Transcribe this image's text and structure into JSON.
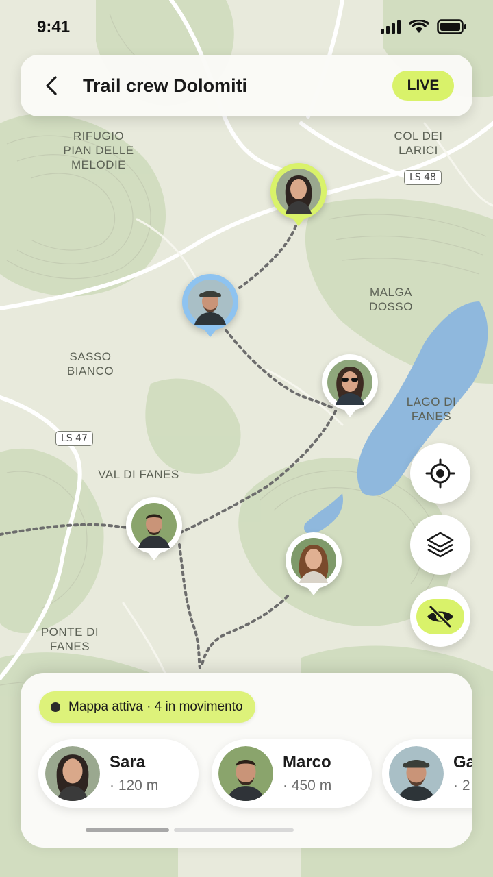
{
  "status_bar": {
    "time": "9:41"
  },
  "header": {
    "title": "Trail crew Dolomiti",
    "live_label": "LIVE"
  },
  "map": {
    "labels": [
      "RIFUGIO\nPIAN DELLE\nMELODIE",
      "COL DEI\nLARICI",
      "MALGA\nDOSSO",
      "SASSO\nBIANCO",
      "LAGO DI\nFANES",
      "VAL DI FANES",
      "PONTE DI\nFANES"
    ],
    "road_shields": [
      "LS 48",
      "LS 47"
    ]
  },
  "controls": {
    "locate": "crosshair-icon",
    "layers": "layers-icon",
    "visibility": "eye-off-icon"
  },
  "sheet": {
    "status": "Mappa attiva · 4 in movimento",
    "members": [
      {
        "name": "Sara",
        "distance": "· 120 m"
      },
      {
        "name": "Marco",
        "distance": "· 450 m"
      },
      {
        "name": "Ga",
        "distance": "· 2"
      }
    ]
  },
  "colors": {
    "accent": "#d9f26a",
    "blue_ring": "#8ec3f0",
    "lake": "#8fb8dd",
    "trail": "#6d6d6d"
  }
}
